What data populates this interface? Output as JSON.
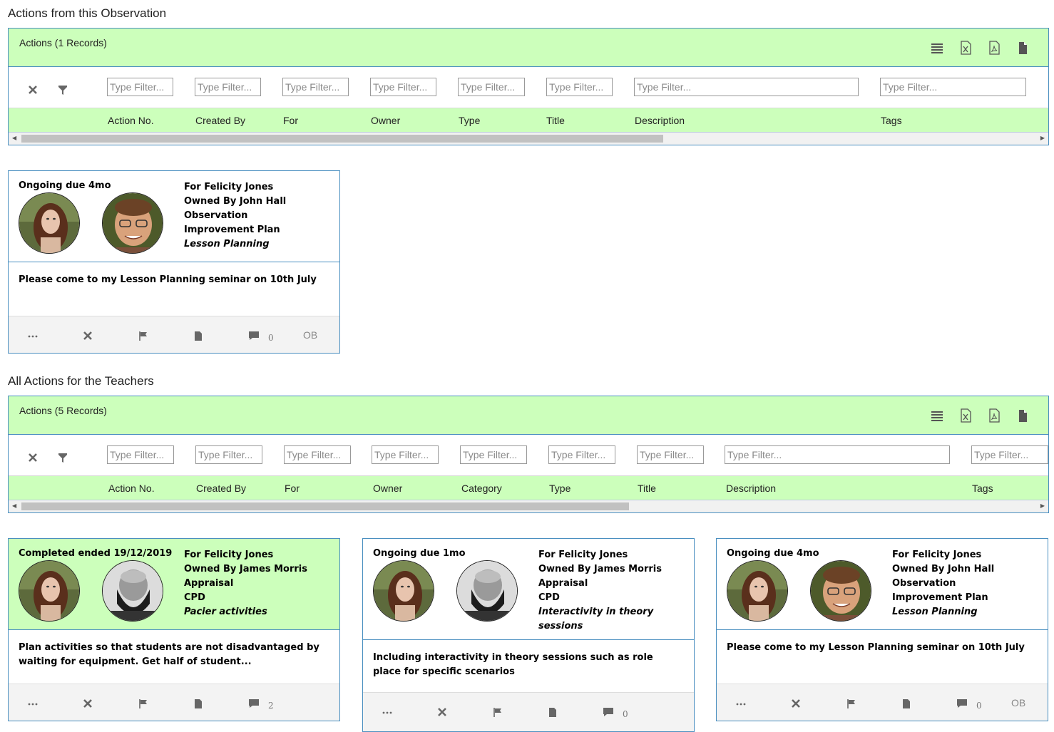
{
  "observation": {
    "heading": "Actions from this Observation",
    "grid": {
      "title": "Actions (1 Records)",
      "filter_placeholder": "Type Filter...",
      "columns": [
        "Action No.",
        "Created By",
        "For",
        "Owner",
        "Type",
        "Title",
        "Description",
        "Tags"
      ]
    },
    "cards": [
      {
        "status": "Ongoing due 4mo",
        "for": "For Felicity Jones",
        "owner": "Owned By John Hall",
        "line1": "Observation",
        "line2": "Improvement Plan",
        "title": "Lesson Planning",
        "description": "Please come to my Lesson Planning seminar on 10th July",
        "comments": "0",
        "tag": "OB"
      }
    ]
  },
  "teachers": {
    "heading": "All Actions for the Teachers",
    "grid": {
      "title": "Actions (5 Records)",
      "filter_placeholder": "Type Filter...",
      "columns": [
        "Action No.",
        "Created By",
        "For",
        "Owner",
        "Category",
        "Type",
        "Title",
        "Description",
        "Tags"
      ]
    },
    "cards": [
      {
        "status": "Completed ended 19/12/2019",
        "for": "For Felicity Jones",
        "owner": "Owned By James Morris",
        "line1": "Appraisal",
        "line2": "CPD",
        "title": "Pacier activities",
        "description": "Plan activities so that students are not disadvantaged by waiting for equipment. Get half of student...",
        "comments": "2",
        "tag": ""
      },
      {
        "status": "Ongoing due 1mo",
        "for": "For Felicity Jones",
        "owner": "Owned By James Morris",
        "line1": "Appraisal",
        "line2": "CPD",
        "title": "Interactivity in theory sessions",
        "description": "Including interactivity in theory sessions such as role place for specific scenarios",
        "comments": "0",
        "tag": ""
      },
      {
        "status": "Ongoing due 4mo",
        "for": "For Felicity Jones",
        "owner": "Owned By John Hall",
        "line1": "Observation",
        "line2": "Improvement Plan",
        "title": "Lesson Planning",
        "description": "Please come to my Lesson Planning seminar on 10th July",
        "comments": "0",
        "tag": "OB"
      }
    ]
  },
  "icons": {
    "grid_tools": [
      "list-icon",
      "excel-export-icon",
      "pdf-export-icon",
      "document-export-icon"
    ],
    "filter_controls": [
      "clear-filter-icon",
      "filter-icon"
    ],
    "card_actions": [
      "more-icon",
      "close-icon",
      "flag-icon",
      "document-icon",
      "comment-icon"
    ]
  },
  "colors": {
    "header_green": "#ccffbb",
    "border_blue": "#4a8fc0",
    "footer_grey": "#f3f3f3"
  }
}
